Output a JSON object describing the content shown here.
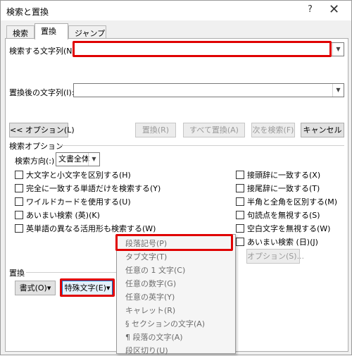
{
  "window": {
    "title": "検索と置換",
    "help": "?",
    "close": "✕"
  },
  "tabs": [
    {
      "label": "検索"
    },
    {
      "label": "置換"
    },
    {
      "label": "ジャンプ"
    }
  ],
  "find": {
    "label": "検索する文字列(N):",
    "value": ""
  },
  "replace": {
    "label": "置換後の文字列(I):",
    "value": ""
  },
  "buttons": {
    "options": "<< オプション(L)",
    "replace": "置換(R)",
    "replace_all": "すべて置換(A)",
    "find_next": "次を検索(F)",
    "cancel": "キャンセル"
  },
  "search_options": {
    "title": "検索オプション",
    "direction_label": "検索方向(:)",
    "direction_value": "文書全体",
    "left_options": [
      "大文字と小文字を区別する(H)",
      "完全に一致する単語だけを検索する(Y)",
      "ワイルドカードを使用する(U)",
      "あいまい検索 (英)(K)",
      "英単語の異なる活用形も検索する(W)"
    ],
    "right_options": [
      "接頭辞に一致する(X)",
      "接尾辞に一致する(T)",
      "半角と全角を区別する(M)",
      "句読点を無視する(S)",
      "空白文字を無視する(W)",
      "あいまい検索 (日)(J)"
    ],
    "options_button": "オプション(S)..."
  },
  "replace_section": {
    "title": "置換",
    "format_button": "書式(O)▾",
    "special_button": "特殊文字(E)▾"
  },
  "special_menu": {
    "items": [
      "段落記号(P)",
      "タブ文字(T)",
      "任意の 1 文字(C)",
      "任意の数字(G)",
      "任意の英字(Y)",
      "キャレット(R)",
      "§ セクションの文字(A)",
      "¶ 段落の文字(A)",
      "段区切り(U)"
    ]
  },
  "colors": {
    "highlight": "#e00000",
    "dialog_bg": "#f0f0f0",
    "focus": "#0078d7"
  }
}
